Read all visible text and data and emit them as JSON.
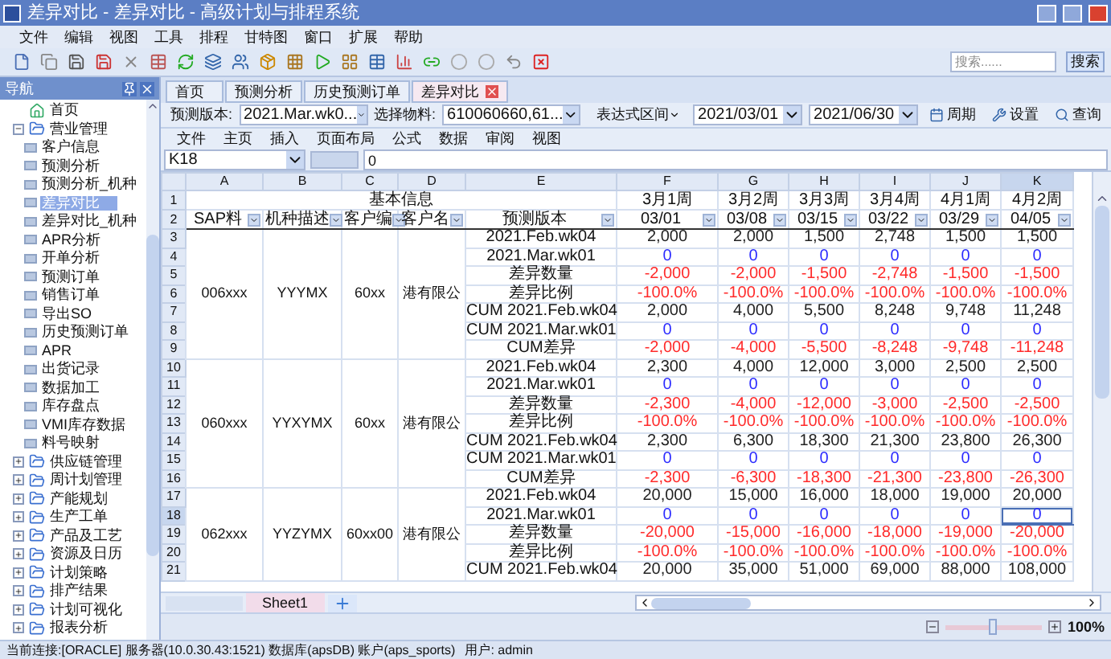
{
  "window": {
    "title": "差异对比 - 差异对比 - 高级计划与排程系统"
  },
  "menu": [
    "文件",
    "编辑",
    "视图",
    "工具",
    "排程",
    "甘特图",
    "窗口",
    "扩展",
    "帮助"
  ],
  "search": {
    "placeholder": "搜索......",
    "button": "搜索"
  },
  "sidebar": {
    "title": "导航",
    "items": [
      {
        "label": "首页",
        "kind": "home"
      },
      {
        "label": "营业管理",
        "kind": "folder",
        "expanded": true,
        "children": [
          {
            "label": "客户信息",
            "selected": false
          },
          {
            "label": "预测分析",
            "selected": false
          },
          {
            "label": "预测分析_机种",
            "selected": false
          },
          {
            "label": "差异对比",
            "selected": true
          },
          {
            "label": "差异对比_机种",
            "selected": false
          },
          {
            "label": "APR分析",
            "selected": false
          },
          {
            "label": "开单分析",
            "selected": false
          },
          {
            "label": "预测订单",
            "selected": false
          },
          {
            "label": "销售订单",
            "selected": false
          },
          {
            "label": "导出SO",
            "selected": false
          },
          {
            "label": "历史预测订单",
            "selected": false
          },
          {
            "label": "APR",
            "selected": false
          },
          {
            "label": "出货记录",
            "selected": false
          },
          {
            "label": "数据加工",
            "selected": false
          },
          {
            "label": "库存盘点",
            "selected": false
          },
          {
            "label": "VMI库存数据",
            "selected": false
          },
          {
            "label": "料号映射",
            "selected": false
          }
        ]
      },
      {
        "label": "供应链管理",
        "kind": "folder",
        "expanded": false
      },
      {
        "label": "周计划管理",
        "kind": "folder",
        "expanded": false
      },
      {
        "label": "产能规划",
        "kind": "folder",
        "expanded": false
      },
      {
        "label": "生产工单",
        "kind": "folder",
        "expanded": false
      },
      {
        "label": "产品及工艺",
        "kind": "folder",
        "expanded": false
      },
      {
        "label": "资源及日历",
        "kind": "folder",
        "expanded": false
      },
      {
        "label": "计划策略",
        "kind": "folder",
        "expanded": false
      },
      {
        "label": "排产结果",
        "kind": "folder",
        "expanded": false
      },
      {
        "label": "计划可视化",
        "kind": "folder",
        "expanded": false
      },
      {
        "label": "报表分析",
        "kind": "folder",
        "expanded": false
      }
    ]
  },
  "doc_tabs": [
    {
      "label": "首页",
      "selected": false
    },
    {
      "label": "预测分析",
      "selected": false
    },
    {
      "label": "历史预测订单",
      "selected": false
    },
    {
      "label": "差异对比",
      "selected": true
    }
  ],
  "filters": {
    "version_label": "预测版本:",
    "version_value": "2021.Mar.wk0...",
    "material_label": "选择物料:",
    "material_value": "610060660,61...",
    "range_label": "表达式区间",
    "start_date": "2021/03/01",
    "end_date": "2021/06/30",
    "buttons": [
      "周期",
      "设置",
      "查询"
    ]
  },
  "ribbon_tabs": [
    "文件",
    "主页",
    "插入",
    "页面布局",
    "公式",
    "数据",
    "审阅",
    "视图"
  ],
  "formula_bar": {
    "name_box": "K18",
    "value": "0"
  },
  "grid": {
    "columns": [
      {
        "letter": "A",
        "selected": false
      },
      {
        "letter": "B",
        "selected": false
      },
      {
        "letter": "C",
        "selected": false
      },
      {
        "letter": "D",
        "selected": false
      },
      {
        "letter": "E",
        "selected": false
      },
      {
        "letter": "F",
        "selected": false
      },
      {
        "letter": "G",
        "selected": false
      },
      {
        "letter": "H",
        "selected": false
      },
      {
        "letter": "I",
        "selected": false
      },
      {
        "letter": "J",
        "selected": false
      },
      {
        "letter": "K",
        "selected": true
      }
    ],
    "header_rows": [
      "1",
      "2"
    ],
    "title": "基本信息",
    "filter_headers": [
      "SAP料",
      "机种描述",
      "客户编",
      "客户名",
      "预测版本"
    ],
    "periods": [
      {
        "week": "3月1周",
        "date": "03/01"
      },
      {
        "week": "3月2周",
        "date": "03/08"
      },
      {
        "week": "3月3周",
        "date": "03/15"
      },
      {
        "week": "3月4周",
        "date": "03/22"
      },
      {
        "week": "4月1周",
        "date": "03/29"
      },
      {
        "week": "4月2周",
        "date": "04/05"
      }
    ],
    "groups": [
      {
        "sap": "006xxx",
        "model": "YYYMX",
        "customer_code": "60xx",
        "customer_name": "港有限公",
        "rows": [
          {
            "number": "3",
            "version": "2021.Feb.wk04",
            "kind": "plain",
            "selected": false,
            "values": [
              "2,000",
              "2,000",
              "1,500",
              "2,748",
              "1,500",
              "1,500"
            ]
          },
          {
            "number": "4",
            "version": "2021.Mar.wk01",
            "kind": "zero",
            "selected": false,
            "values": [
              "0",
              "0",
              "0",
              "0",
              "0",
              "0"
            ]
          },
          {
            "number": "5",
            "version": "差异数量",
            "kind": "negative",
            "selected": false,
            "values": [
              "-2,000",
              "-2,000",
              "-1,500",
              "-2,748",
              "-1,500",
              "-1,500"
            ]
          },
          {
            "number": "6",
            "version": "差异比例",
            "kind": "negative",
            "selected": false,
            "values": [
              "-100.0%",
              "-100.0%",
              "-100.0%",
              "-100.0%",
              "-100.0%",
              "-100.0%"
            ]
          },
          {
            "number": "7",
            "version": "CUM 2021.Feb.wk04",
            "kind": "plain",
            "selected": false,
            "values": [
              "2,000",
              "4,000",
              "5,500",
              "8,248",
              "9,748",
              "11,248"
            ]
          },
          {
            "number": "8",
            "version": "CUM 2021.Mar.wk01",
            "kind": "zero",
            "selected": false,
            "values": [
              "0",
              "0",
              "0",
              "0",
              "0",
              "0"
            ]
          },
          {
            "number": "9",
            "version": "CUM差异",
            "kind": "negative",
            "selected": false,
            "values": [
              "-2,000",
              "-4,000",
              "-5,500",
              "-8,248",
              "-9,748",
              "-11,248"
            ]
          }
        ]
      },
      {
        "sap": "060xxx",
        "model": "YYXYMX",
        "customer_code": "60xx",
        "customer_name": "港有限公",
        "rows": [
          {
            "number": "10",
            "version": "2021.Feb.wk04",
            "kind": "plain",
            "selected": false,
            "values": [
              "2,300",
              "4,000",
              "12,000",
              "3,000",
              "2,500",
              "2,500"
            ]
          },
          {
            "number": "11",
            "version": "2021.Mar.wk01",
            "kind": "zero",
            "selected": false,
            "values": [
              "0",
              "0",
              "0",
              "0",
              "0",
              "0"
            ]
          },
          {
            "number": "12",
            "version": "差异数量",
            "kind": "negative",
            "selected": false,
            "values": [
              "-2,300",
              "-4,000",
              "-12,000",
              "-3,000",
              "-2,500",
              "-2,500"
            ]
          },
          {
            "number": "13",
            "version": "差异比例",
            "kind": "negative",
            "selected": false,
            "values": [
              "-100.0%",
              "-100.0%",
              "-100.0%",
              "-100.0%",
              "-100.0%",
              "-100.0%"
            ]
          },
          {
            "number": "14",
            "version": "CUM 2021.Feb.wk04",
            "kind": "plain",
            "selected": false,
            "values": [
              "2,300",
              "6,300",
              "18,300",
              "21,300",
              "23,800",
              "26,300"
            ]
          },
          {
            "number": "15",
            "version": "CUM 2021.Mar.wk01",
            "kind": "zero",
            "selected": false,
            "values": [
              "0",
              "0",
              "0",
              "0",
              "0",
              "0"
            ]
          },
          {
            "number": "16",
            "version": "CUM差异",
            "kind": "negative",
            "selected": false,
            "values": [
              "-2,300",
              "-6,300",
              "-18,300",
              "-21,300",
              "-23,800",
              "-26,300"
            ]
          }
        ]
      },
      {
        "sap": "062xxx",
        "model": "YYZYMX",
        "customer_code": "60xx00",
        "customer_name": "港有限公",
        "rows": [
          {
            "number": "17",
            "version": "2021.Feb.wk04",
            "kind": "plain",
            "selected": false,
            "values": [
              "20,000",
              "15,000",
              "16,000",
              "18,000",
              "19,000",
              "20,000"
            ]
          },
          {
            "number": "18",
            "version": "2021.Mar.wk01",
            "kind": "zero",
            "selected": true,
            "values": [
              "0",
              "0",
              "0",
              "0",
              "0",
              "0"
            ]
          },
          {
            "number": "19",
            "version": "差异数量",
            "kind": "negative",
            "selected": false,
            "values": [
              "-20,000",
              "-15,000",
              "-16,000",
              "-18,000",
              "-19,000",
              "-20,000"
            ]
          },
          {
            "number": "20",
            "version": "差异比例",
            "kind": "negative",
            "selected": false,
            "values": [
              "-100.0%",
              "-100.0%",
              "-100.0%",
              "-100.0%",
              "-100.0%",
              "-100.0%"
            ]
          },
          {
            "number": "21",
            "version": "CUM 2021.Feb.wk04",
            "kind": "plain",
            "selected": false,
            "values": [
              "20,000",
              "35,000",
              "51,000",
              "69,000",
              "88,000",
              "108,000"
            ]
          }
        ]
      }
    ]
  },
  "sheet_tabs": [
    {
      "label": "Sheet1",
      "selected": true
    }
  ],
  "zoom": {
    "level": 0.5,
    "reading": "100%"
  },
  "status_bar": {
    "connection": "当前连接:[ORACLE] 服务器(10.0.30.43:1521) 数据库(apsDB) 账户(aps_sports)",
    "user": "用户: admin"
  }
}
